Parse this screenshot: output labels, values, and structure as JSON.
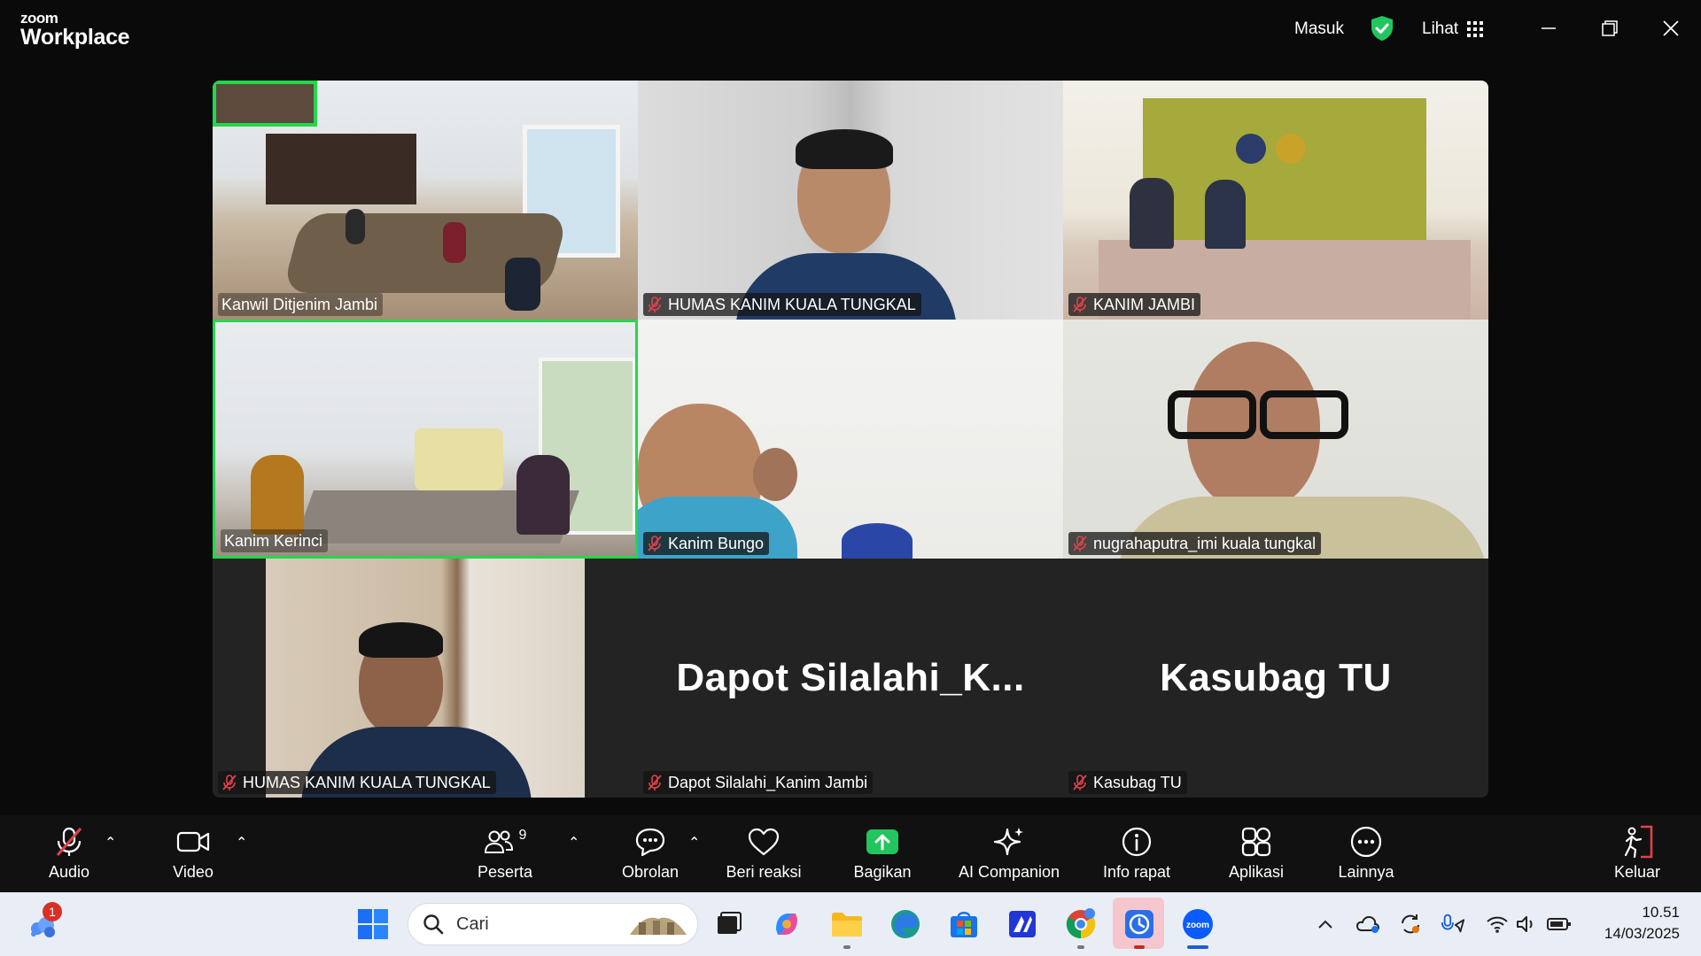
{
  "app": {
    "logo_small": "zoom",
    "logo_big": "Workplace",
    "signin_label": "Masuk",
    "view_label": "Lihat"
  },
  "tiles": [
    {
      "name": "Kanwil Ditjenim Jambi",
      "muted": false
    },
    {
      "name": "HUMAS KANIM KUALA TUNGKAL",
      "muted": true
    },
    {
      "name": "KANIM JAMBI",
      "muted": true
    },
    {
      "name": "Kanim Kerinci",
      "muted": false
    },
    {
      "name": "Kanim Bungo",
      "muted": true
    },
    {
      "name": "nugrahaputra_imi kuala tungkal",
      "muted": true
    },
    {
      "name": "HUMAS KANIM KUALA TUNGKAL",
      "muted": true
    },
    {
      "name": "Dapot Silalahi_Kanim Jambi",
      "display": "Dapot  Silalahi_K...",
      "muted": true
    },
    {
      "name": "Kasubag TU",
      "display": "Kasubag TU",
      "muted": true
    }
  ],
  "toolbar": {
    "audio": "Audio",
    "video": "Video",
    "participants": "Peserta",
    "participants_count": "9",
    "chat": "Obrolan",
    "reactions": "Beri reaksi",
    "share": "Bagikan",
    "ai": "AI Companion",
    "info": "Info rapat",
    "apps": "Aplikasi",
    "more": "Lainnya",
    "leave": "Keluar"
  },
  "taskbar": {
    "search_placeholder": "Cari",
    "widget_badge": "1",
    "time": "10.51",
    "date": "14/03/2025"
  },
  "colors": {
    "active_speaker": "#22d84a",
    "share_green": "#22c55e",
    "leave_red": "#e0424a",
    "muted_red": "#e0424a"
  }
}
